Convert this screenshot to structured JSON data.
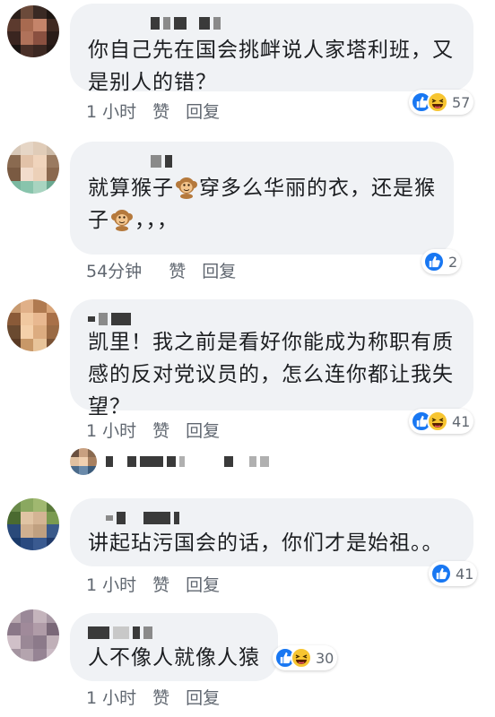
{
  "comments": [
    {
      "text": "你自己先在国会挑衅说人家塔利班，又是别人的错？",
      "time": "1 小时",
      "like": "赞",
      "reply": "回复",
      "reactions": {
        "types": [
          "like-icon",
          "haha-icon"
        ],
        "count": "57"
      }
    },
    {
      "text_part1": "就算猴子",
      "text_part2": "穿多么华丽的衣，还是猴",
      "text_part3": "子",
      "text_part4": "，，，",
      "emoji": "monkey-emoji",
      "time": "54分钟",
      "like": "赞",
      "reply": "回复",
      "reactions": {
        "types": [
          "like-icon"
        ],
        "count": "2"
      }
    },
    {
      "text": "凯里！我之前是看好你能成为称职有质感的反对党议员的，怎么连你都让我失望？",
      "time": "1 小时",
      "like": "赞",
      "reply": "回复",
      "reactions": {
        "types": [
          "like-icon",
          "haha-icon"
        ],
        "count": "41"
      }
    },
    {
      "text": "讲起玷污国会的话，你们才是始祖。。",
      "time": "1 小时",
      "like": "赞",
      "reply": "回复",
      "reactions": {
        "types": [
          "like-icon"
        ],
        "count": "41"
      }
    },
    {
      "text": "人不像人就像人猿",
      "time": "1 小时",
      "like": "赞",
      "reply": "回复",
      "reactions": {
        "types": [
          "like-icon",
          "haha-icon"
        ],
        "count": "30"
      }
    }
  ],
  "colors": {
    "bubble": "#f0f2f5",
    "like_blue": "#1877f2",
    "haha_yellow": "#f7c531",
    "meta_gray": "#606770"
  }
}
